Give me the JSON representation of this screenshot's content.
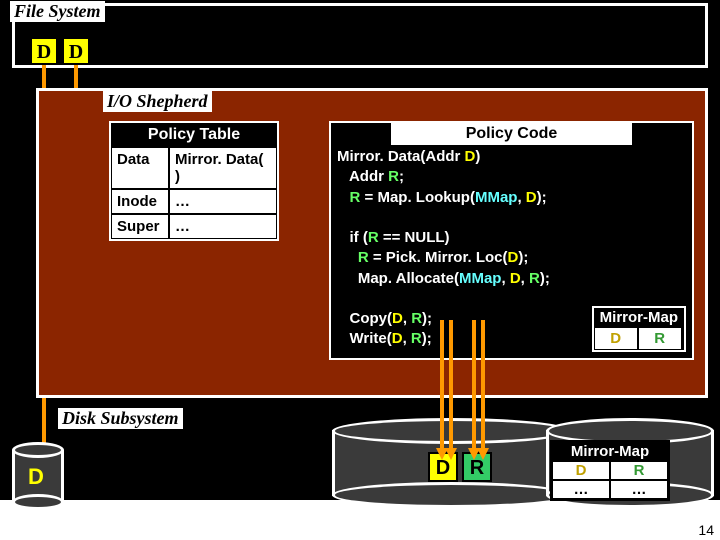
{
  "fs": {
    "label": "File System",
    "D": "D"
  },
  "shepherd": {
    "label": "I/O Shepherd",
    "policyTable": {
      "title": "Policy Table",
      "rows": [
        {
          "k": "Data",
          "v": "Mirror. Data( )"
        },
        {
          "k": "Inode",
          "v": "…"
        },
        {
          "k": "Super",
          "v": "…"
        }
      ]
    },
    "policyCode": {
      "title": "Policy Code"
    },
    "code": {
      "l1a": "Mirror. Data(",
      "l1b": "Addr ",
      "l1c": "D",
      "l1d": ")",
      "l2a": "   Addr ",
      "l2b": "R",
      "l2c": ";",
      "l3a": "   ",
      "l3b": "R",
      "l3c": " = Map. Lookup(",
      "l3d": "MMap",
      "l3e": ", ",
      "l3f": "D",
      "l3g": ");",
      "l5a": "   if (",
      "l5b": "R",
      "l5c": " == NULL)",
      "l6a": "     ",
      "l6b": "R",
      "l6c": " = Pick. Mirror. Loc(",
      "l6d": "D",
      "l6e": ");",
      "l7a": "     Map. Allocate(",
      "l7b": "MMap",
      "l7c": ", ",
      "l7d": "D",
      "l7e": ", ",
      "l7f": "R",
      "l7g": ");",
      "l9a": "   Copy(",
      "l9b": "D",
      "l9c": ", ",
      "l9d": "R",
      "l9e": ");",
      "l10a": "   Write(",
      "l10b": "D",
      "l10c": ", ",
      "l10d": "R",
      "l10e": ");"
    },
    "mirrorMap": {
      "title": "Mirror-Map",
      "D": "D",
      "R": "R"
    }
  },
  "diskSubsystem": {
    "label": "Disk Subsystem",
    "D": "D",
    "R": "R",
    "mirrorMap": {
      "title": "Mirror-Map",
      "D": "D",
      "R": "R",
      "dots": "…"
    }
  },
  "slideNumber": "14"
}
